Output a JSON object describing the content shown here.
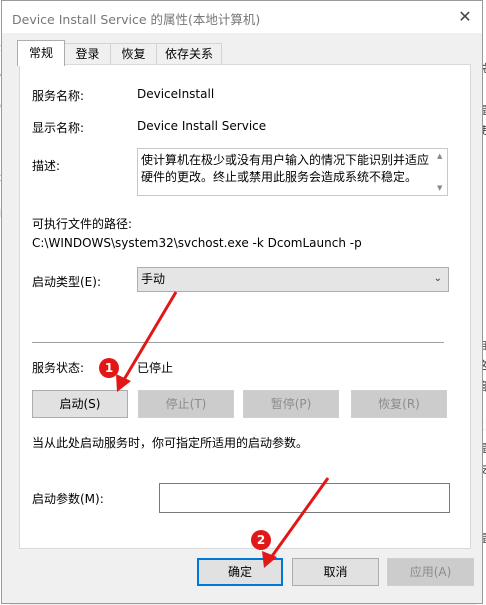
{
  "window": {
    "title": "Device Install Service 的属性(本地计算机)",
    "close_label": "✕"
  },
  "tabs": [
    "常规",
    "登录",
    "恢复",
    "依存关系"
  ],
  "service": {
    "name_label": "服务名称:",
    "name_value": "DeviceInstall",
    "display_label": "显示名称:",
    "display_value": "Device Install Service",
    "desc_label": "描述:",
    "desc_value": "使计算机在极少或没有用户输入的情况下能识别并适应硬件的更改。终止或禁用此服务会造成系统不稳定。",
    "path_label": "可执行文件的路径:",
    "path_value": "C:\\WINDOWS\\system32\\svchost.exe -k DcomLaunch -p",
    "startup_type_label": "启动类型(E):",
    "startup_type_value": "手动",
    "status_label": "服务状态:",
    "status_value": "已停止"
  },
  "control_buttons": {
    "start": "启动(S)",
    "stop": "停止(T)",
    "pause": "暂停(P)",
    "resume": "恢复(R)"
  },
  "hint": "当从此处启动服务时，你可指定所适用的启动参数。",
  "params": {
    "label": "启动参数(M):",
    "value": ""
  },
  "footer_buttons": {
    "ok": "确定",
    "cancel": "取消",
    "apply": "应用(A)"
  },
  "annotations": {
    "step1": "1",
    "step2": "2",
    "color": "#e21818"
  },
  "background_fragments": {
    "left": [
      "务",
      "e",
      "0",
      "述",
      "b",
      "时"
    ],
    "right": [
      "说",
      "提",
      "使",
      "自",
      "这",
      "管",
      "E",
      "提",
      "支",
      "提"
    ]
  }
}
